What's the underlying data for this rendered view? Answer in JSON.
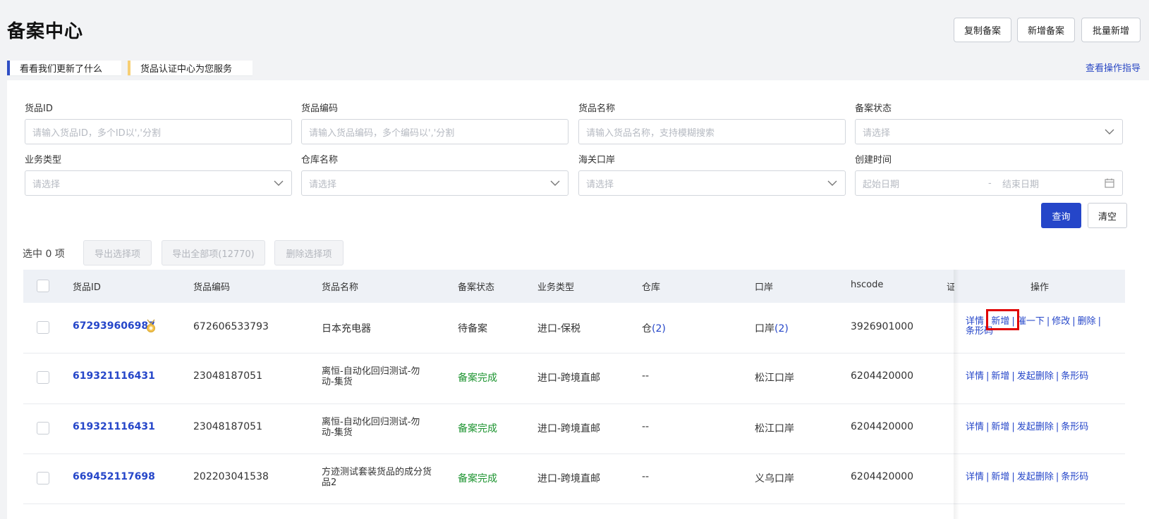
{
  "header": {
    "title": "备案中心",
    "buttons": [
      "复制备案",
      "新增备案",
      "批量新增"
    ]
  },
  "notices": [
    "看看我们更新了什么",
    "货品认证中心为您服务"
  ],
  "guide_link": "查看操作指导",
  "filters": {
    "goods_id": {
      "label": "货品ID",
      "placeholder": "请输入货品ID，多个ID以','分割"
    },
    "goods_code": {
      "label": "货品编码",
      "placeholder": "请输入货品编码，多个编码以','分割"
    },
    "goods_name": {
      "label": "货品名称",
      "placeholder": "请输入货品名称，支持模糊搜索"
    },
    "filing_status": {
      "label": "备案状态",
      "placeholder": "请选择"
    },
    "business_type": {
      "label": "业务类型",
      "placeholder": "请选择"
    },
    "warehouse": {
      "label": "仓库名称",
      "placeholder": "请选择"
    },
    "customs_port": {
      "label": "海关口岸",
      "placeholder": "请选择"
    },
    "created_time": {
      "label": "创建时间",
      "start_placeholder": "起始日期",
      "separator": "-",
      "end_placeholder": "结束日期"
    }
  },
  "actions": {
    "query": "查询",
    "clear": "清空"
  },
  "selection": {
    "count_text": "选中 0 项",
    "export_selected": "导出选择项",
    "export_all": "导出全部项(12770)",
    "delete_selected": "删除选择项"
  },
  "table": {
    "columns": [
      "货品ID",
      "货品编码",
      "货品名称",
      "备案状态",
      "业务类型",
      "仓库",
      "口岸",
      "hscode",
      "证",
      "操作"
    ],
    "rows": [
      {
        "id": "672939606987",
        "code": "672606533793",
        "name": "日本充电器",
        "status": "待备案",
        "status_type": "pending",
        "biz": "进口-保税",
        "warehouse_text": "仓",
        "warehouse_count": "(2)",
        "port_text": "口岸",
        "port_count": "(2)",
        "hscode": "3926901000",
        "ops_line1": [
          "详情",
          "新增",
          "催一下",
          "修改",
          "删除"
        ],
        "ops_line2": "条形码"
      },
      {
        "id": "619321116431",
        "code": "23048187051",
        "name_line1": "离恒-自动化回归测试-勿",
        "name_line2": "动-集货",
        "status": "备案完成",
        "status_type": "done",
        "biz": "进口-跨境直邮",
        "warehouse_plain": "--",
        "port_plain": "松江口岸",
        "hscode": "6204420000",
        "ops": [
          "详情",
          "新增",
          "发起删除",
          "条形码"
        ]
      },
      {
        "id": "619321116431",
        "code": "23048187051",
        "name_line1": "离恒-自动化回归测试-勿",
        "name_line2": "动-集货",
        "status": "备案完成",
        "status_type": "done",
        "biz": "进口-跨境直邮",
        "warehouse_plain": "--",
        "port_plain": "松江口岸",
        "hscode": "6204420000",
        "ops": [
          "详情",
          "新增",
          "发起删除",
          "条形码"
        ]
      },
      {
        "id": "669452117698",
        "code": "202203041538",
        "name_line1": "方迹测试套装货品的成分货",
        "name_line2": "品2",
        "status": "备案完成",
        "status_type": "done",
        "biz": "进口-跨境直邮",
        "warehouse_plain": "--",
        "port_plain": "义乌口岸",
        "hscode": "6204420000",
        "ops": [
          "详情",
          "新增",
          "发起删除",
          "条形码"
        ]
      }
    ]
  },
  "colors": {
    "primary": "#2546c9",
    "success": "#1d9430",
    "highlight": "#e00000"
  },
  "icons": {
    "medal": "medal-icon",
    "chevron": "chevron-down-icon",
    "calendar": "calendar-icon"
  }
}
